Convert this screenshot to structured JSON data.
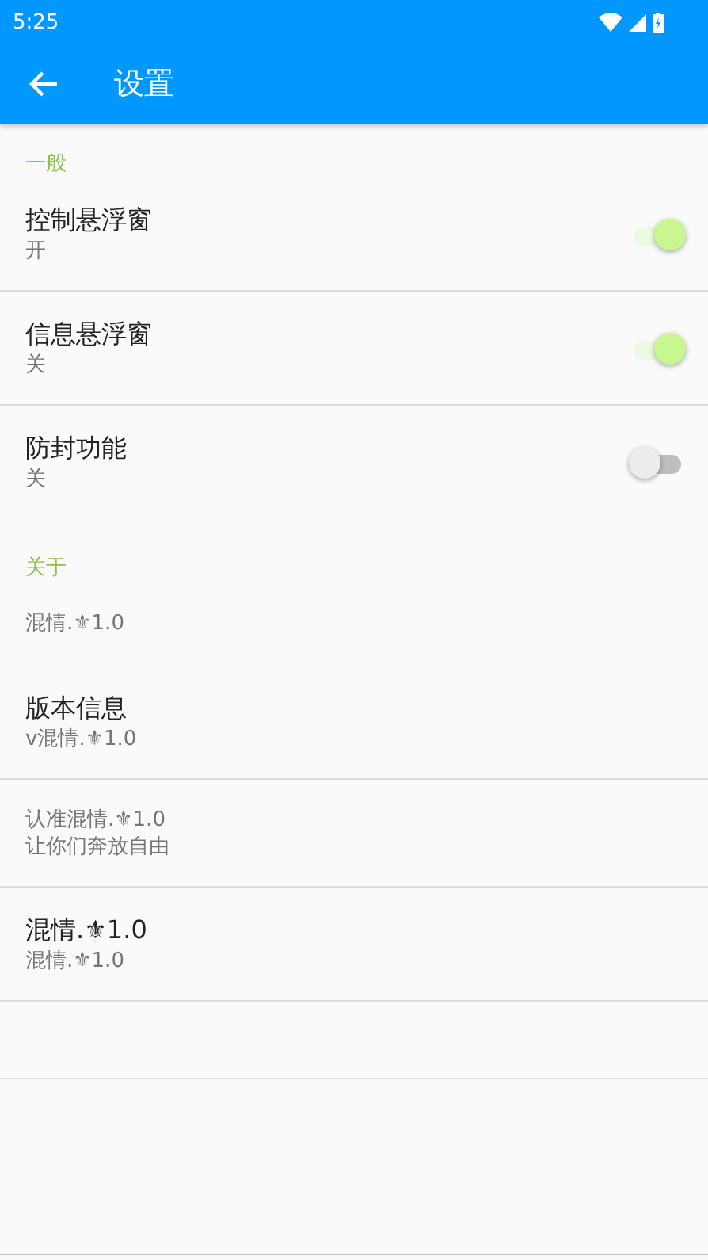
{
  "status_bar": {
    "time": "5:25"
  },
  "toolbar": {
    "title": "设置"
  },
  "sections": [
    {
      "header": "一般",
      "items": [
        {
          "kind": "switch",
          "title": "控制悬浮窗",
          "summary": "开",
          "on": true,
          "divider": true
        },
        {
          "kind": "switch",
          "title": "信息悬浮窗",
          "summary": "关",
          "on": true,
          "divider": true
        },
        {
          "kind": "switch",
          "title": "防封功能",
          "summary": "关",
          "on": false,
          "divider": false
        }
      ]
    },
    {
      "header": "关于",
      "items": [
        {
          "kind": "note",
          "summary": "混情.⚜1.0",
          "divider": false
        },
        {
          "kind": "text",
          "title": "版本信息",
          "summary": "v混情.⚜1.0",
          "divider": true
        },
        {
          "kind": "note",
          "summary": "认准混情.⚜1.0\n让你们奔放自由",
          "divider": true
        },
        {
          "kind": "text",
          "title": "混情.⚜1.0",
          "summary": "混情.⚜1.0",
          "divider": true
        },
        {
          "kind": "empty",
          "divider": true
        }
      ]
    }
  ]
}
